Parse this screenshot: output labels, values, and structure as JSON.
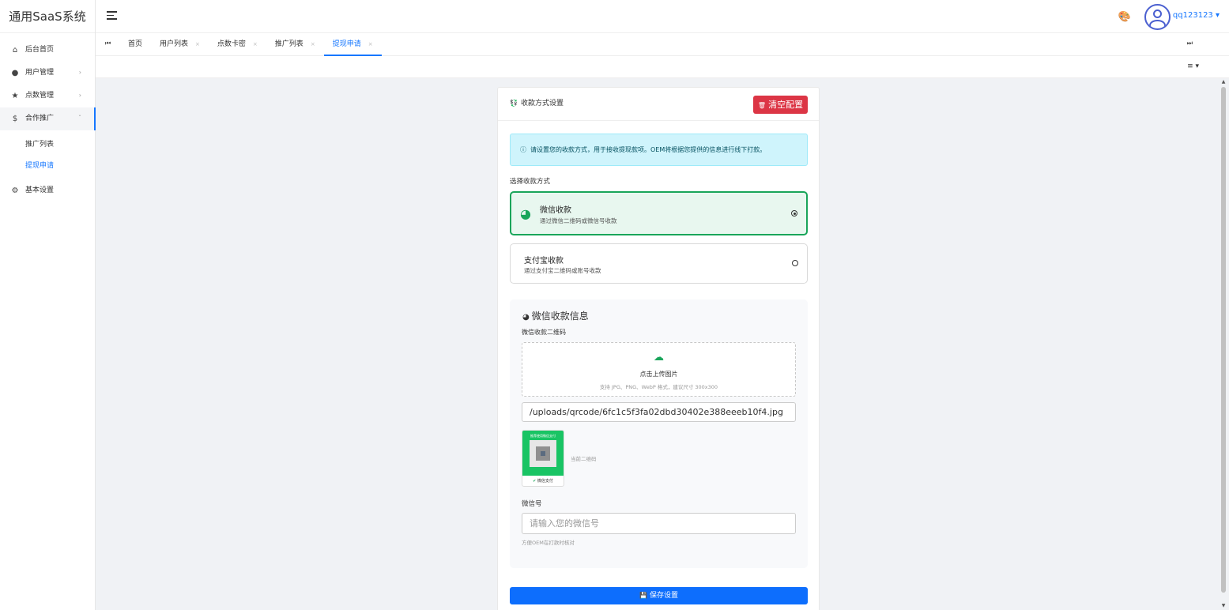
{
  "app": {
    "title": "通用SaaS系统"
  },
  "sidebar": {
    "items": [
      {
        "label": "后台首页",
        "icon": "home-icon"
      },
      {
        "label": "用户管理",
        "icon": "user-icon"
      },
      {
        "label": "点数管理",
        "icon": "star-icon"
      },
      {
        "label": "合作推广",
        "icon": "dollar-icon",
        "children": [
          "推广列表",
          "提现申请"
        ],
        "active_child": "提现申请"
      },
      {
        "label": "基本设置",
        "icon": "gear-icon"
      }
    ]
  },
  "header": {
    "username": "qq123123"
  },
  "tabs": [
    {
      "label": "首页"
    },
    {
      "label": "用户列表"
    },
    {
      "label": "点数卡密"
    },
    {
      "label": "推广列表"
    },
    {
      "label": "提现申请",
      "active": true
    }
  ],
  "card": {
    "title": "收款方式设置",
    "clear_button": "清空配置",
    "info": "请设置您的收款方式，用于接收提现款项。OEM将根据您提供的信息进行线下打款。",
    "choose_label": "选择收款方式",
    "options": [
      {
        "title": "微信收款",
        "desc": "通过微信二维码或微信号收款",
        "selected": true
      },
      {
        "title": "支付宝收款",
        "desc": "通过支付宝二维码或账号收款",
        "selected": false
      }
    ],
    "wechat": {
      "heading": "微信收款信息",
      "qr_label": "微信收款二维码",
      "upload_text": "点击上传图片",
      "upload_hint": "支持 JPG、PNG、WebP 格式，建议尺寸 300x300",
      "qr_path": "/uploads/qrcode/6fc1c5f3fa02dbd30402e388eeeb10f4.jpg",
      "qr_preview_title": "推荐使用微信支付",
      "qr_preview_foot": "微信支付",
      "qr_caption": "当前二维码",
      "id_label": "微信号",
      "id_placeholder": "请输入您的微信号",
      "id_hint": "方便OEM在打款时核对"
    },
    "save_button": "保存设置"
  },
  "colors": {
    "primary": "#1677ff",
    "danger": "#dc3545",
    "wechat_green": "#19a55a",
    "save_blue": "#0d6efd"
  }
}
